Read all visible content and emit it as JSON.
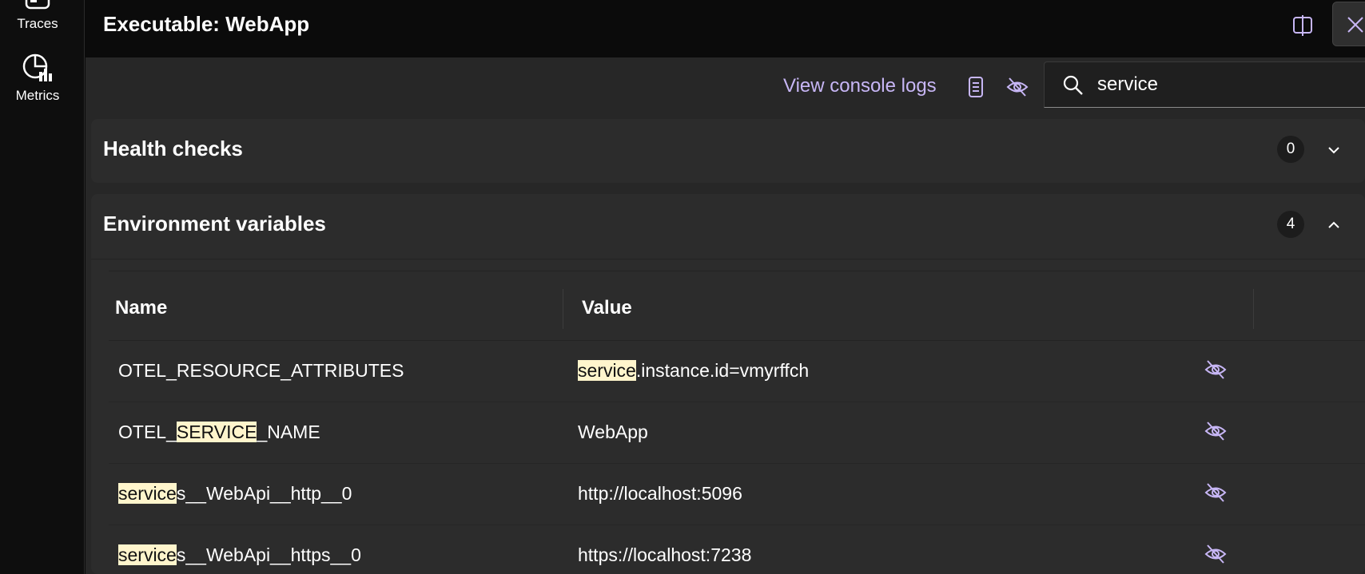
{
  "rail": {
    "items": [
      {
        "label": "Traces",
        "icon": "traces-icon"
      },
      {
        "label": "Metrics",
        "icon": "metrics-icon"
      }
    ]
  },
  "panel": {
    "title": "Executable: WebApp"
  },
  "toolbar": {
    "console_link": "View console logs",
    "search_value": "service"
  },
  "health": {
    "title": "Health checks",
    "count": "0",
    "expanded": false
  },
  "env": {
    "title": "Environment variables",
    "count": "4",
    "expanded": true,
    "columns": {
      "name": "Name",
      "value": "Value"
    },
    "rows": [
      {
        "name": {
          "pre": "OTEL_RESOURCE_ATTRIBUTES",
          "match": "",
          "post": ""
        },
        "value": {
          "pre": "",
          "match": "service",
          "post": ".instance.id=vmyrffch"
        }
      },
      {
        "name": {
          "pre": "OTEL_",
          "match": "SERVICE",
          "post": "_NAME"
        },
        "value": {
          "pre": "WebApp",
          "match": "",
          "post": ""
        }
      },
      {
        "name": {
          "pre": "",
          "match": "service",
          "post": "s__WebApi__http__0"
        },
        "value": {
          "pre": "http://localhost:5096",
          "match": "",
          "post": ""
        }
      },
      {
        "name": {
          "pre": "",
          "match": "service",
          "post": "s__WebApi__https__0"
        },
        "value": {
          "pre": "https://localhost:7238",
          "match": "",
          "post": ""
        }
      }
    ]
  },
  "colors": {
    "accent": "#c7b6f5",
    "highlight": "#fff5cc",
    "section_bg": "#2c2c2c",
    "header_bg": "#0b0b0b"
  }
}
